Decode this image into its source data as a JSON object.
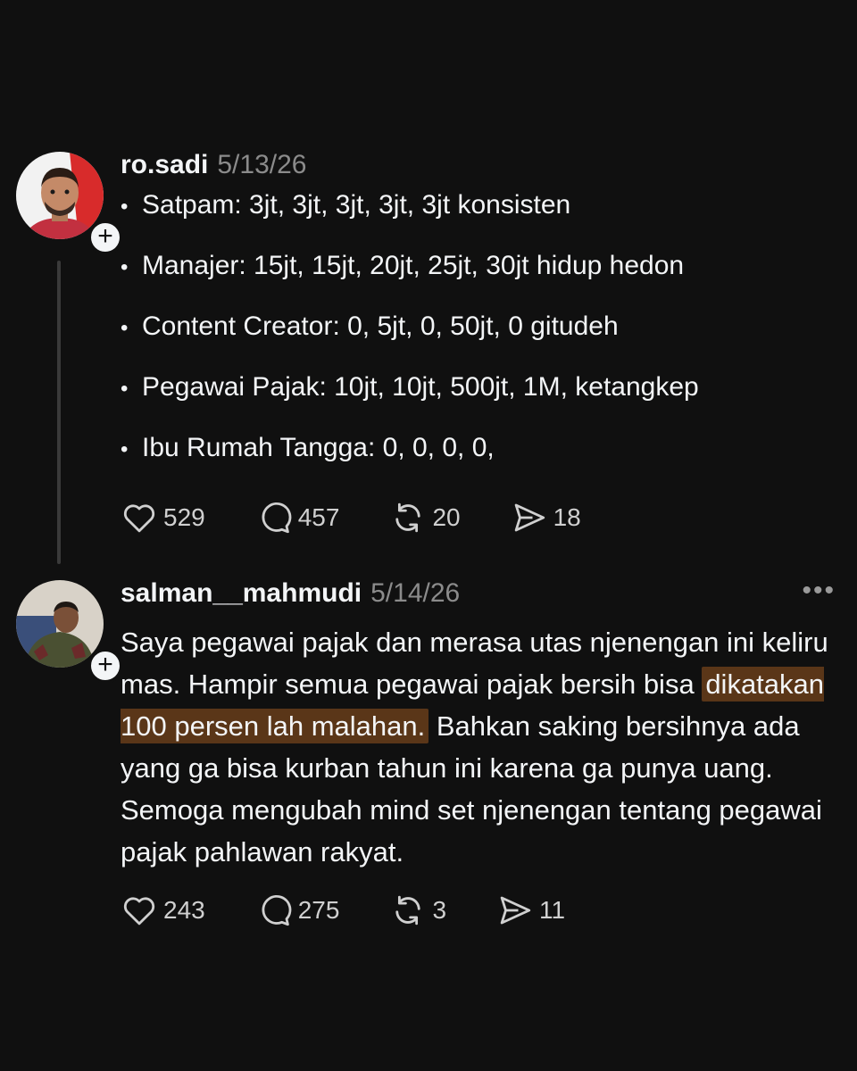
{
  "posts": [
    {
      "username": "ro.sadi",
      "date": "5/13/26",
      "bullets": [
        "Satpam: 3jt, 3jt, 3jt, 3jt, 3jt konsisten",
        "Manajer: 15jt, 15jt, 20jt, 25jt, 30jt hidup hedon",
        "Content Creator: 0, 5jt, 0, 50jt, 0 gitudeh",
        "Pegawai Pajak: 10jt, 10jt, 500jt, 1M, ketangkep",
        "Ibu Rumah Tangga: 0, 0, 0, 0,"
      ],
      "likes": "529",
      "replies": "457",
      "reposts": "20",
      "shares": "18"
    },
    {
      "username": "salman__mahmudi",
      "date": "5/14/26",
      "text_before": "Saya pegawai pajak dan merasa utas njenengan ini keliru mas. Hampir semua pegawai pajak bersih bisa ",
      "text_highlight": "dikatakan 100 persen lah malahan.",
      "text_after": " Bahkan saking bersihnya ada yang ga bisa kurban tahun ini karena ga punya uang. Semoga mengubah mind set njenengan tentang pegawai pajak pahlawan rakyat.",
      "likes": "243",
      "replies": "275",
      "reposts": "3",
      "shares": "11"
    }
  ],
  "bullet_glyph": "•",
  "follow_glyph": "+",
  "more_glyph": "•••",
  "icons": [
    "heart-icon",
    "comment-icon",
    "repost-icon",
    "share-icon",
    "plus-icon",
    "more-icon"
  ],
  "colors": {
    "background": "#101010",
    "text": "#f3f5f7",
    "muted": "#8b8b8b",
    "highlight": "#5a3618"
  }
}
